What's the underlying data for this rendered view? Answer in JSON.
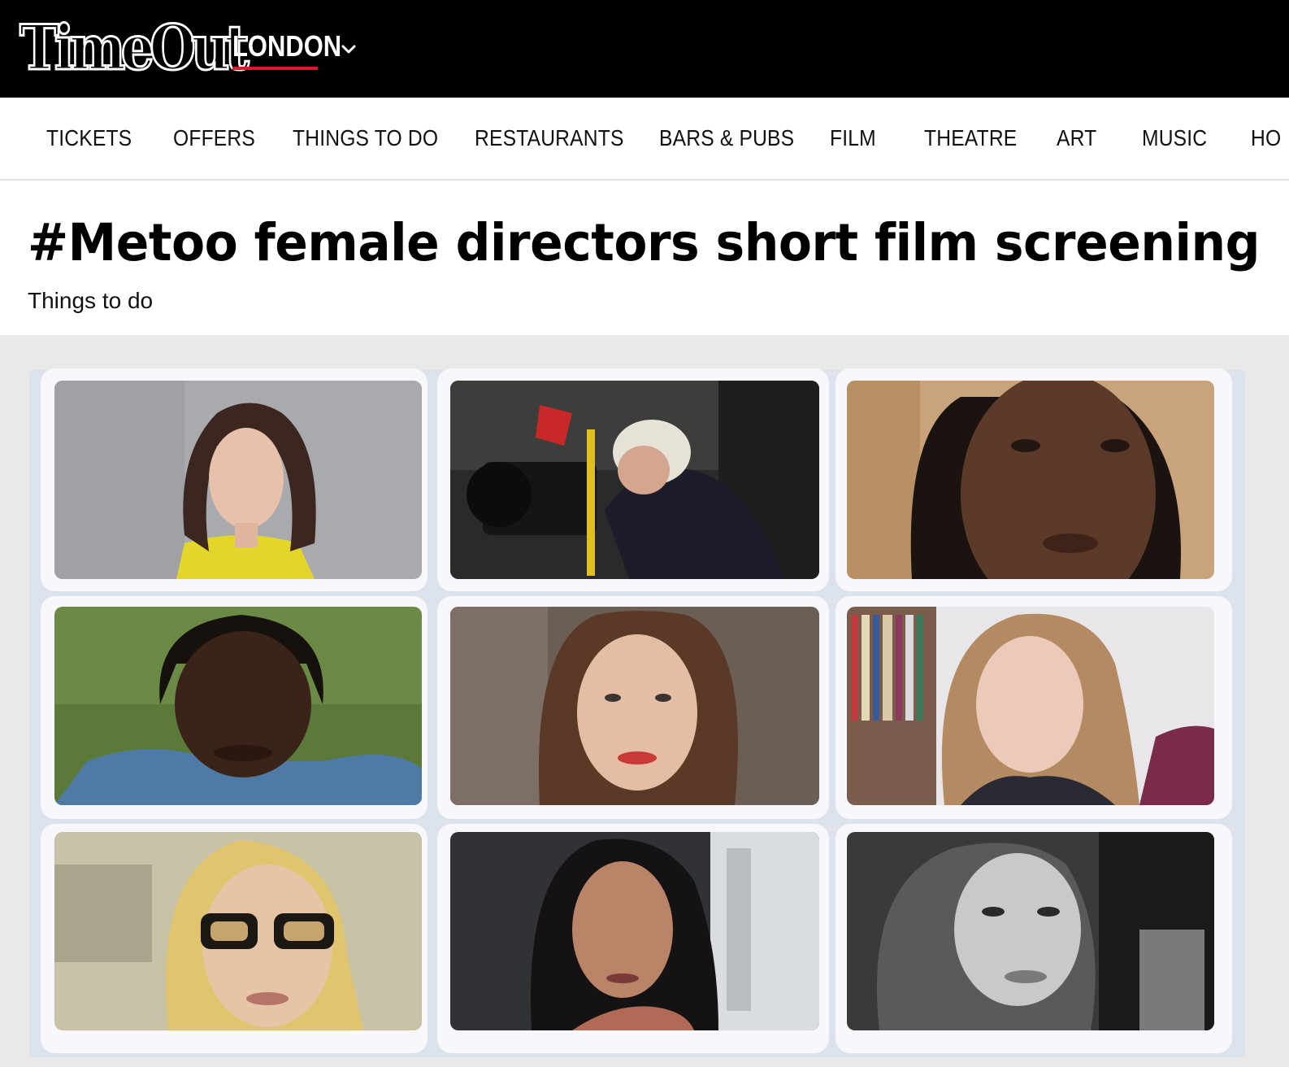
{
  "header": {
    "logo_text": "TimeOut",
    "city": "LONDON",
    "city_underline_color": "#e0162b",
    "dropdown_icon": "chevron-down-icon"
  },
  "nav": {
    "items": [
      {
        "label": "TICKETS"
      },
      {
        "label": "OFFERS"
      },
      {
        "label": "THINGS TO DO"
      },
      {
        "label": "RESTAURANTS"
      },
      {
        "label": "BARS & PUBS"
      },
      {
        "label": "FILM"
      },
      {
        "label": "THEATRE"
      },
      {
        "label": "ART"
      },
      {
        "label": "MUSIC"
      },
      {
        "label": "HO"
      }
    ]
  },
  "article": {
    "title": "#Metoo female directors short film screening",
    "category": "Things to do"
  },
  "gallery": {
    "photos": [
      {
        "description": "portrait-woman-yellow-top"
      },
      {
        "description": "woman-behind-film-camera"
      },
      {
        "description": "portrait-closeup-woman"
      },
      {
        "description": "portrait-woman-denim-jacket"
      },
      {
        "description": "portrait-woman-red-lips"
      },
      {
        "description": "portrait-woman-bookshelf"
      },
      {
        "description": "portrait-woman-glasses"
      },
      {
        "description": "portrait-woman-dark-hair"
      },
      {
        "description": "portrait-woman-black-and-white"
      }
    ]
  }
}
